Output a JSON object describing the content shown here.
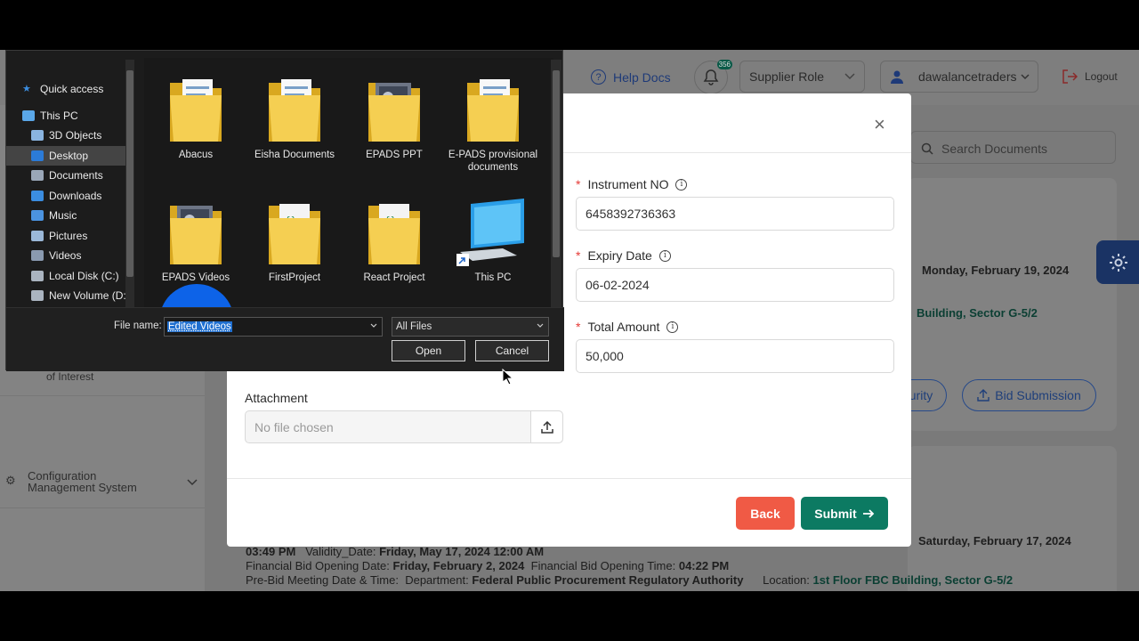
{
  "topbar": {
    "help_docs": "Help Docs",
    "notification_count": "356",
    "role_select": "Supplier Role",
    "username": "dawalancetraders",
    "logout": "Logout"
  },
  "search": {
    "placeholder": "Search Documents"
  },
  "sidebar": {
    "partial_item": "of Interest",
    "config_item": "Configuration Management System"
  },
  "background_cards": {
    "date1_fragment": "Monday, February 19, 2024",
    "location1_fragment": "Building, Sector G-5/2",
    "security_btn": "curity",
    "bid_submission_btn": "Bid Submission",
    "date2_fragment": "Saturday, February 17, 2024",
    "line1_time": "03:49 PM",
    "line1_label": "Validity_Date:",
    "line1_value": "Friday, May 17, 2024 12:00 AM",
    "line2_label": "Financial Bid Opening Date:",
    "line2_value": "Friday, February 2, 2024",
    "line2_label2": "Financial Bid Opening Time:",
    "line2_value2": "04:22 PM",
    "line3_label": "Pre-Bid Meeting Date & Time:",
    "line3_dept_label": "Department:",
    "line3_dept_value": "Federal Public Procurement Regulatory Authority",
    "line3_loc_label": "Location:",
    "line3_loc_value": "1st Floor FBC Building, Sector G-5/2"
  },
  "modal": {
    "close_symbol": "×",
    "instrument_label": "Instrument NO",
    "instrument_value": "6458392736363",
    "expiry_label": "Expiry Date",
    "expiry_value": "06-02-2024",
    "amount_label": "Total Amount",
    "amount_value": "50,000",
    "attachment_label": "Attachment",
    "file_placeholder": "No file chosen",
    "back_label": "Back",
    "submit_label": "Submit"
  },
  "file_dialog": {
    "nav_items": [
      {
        "label": "Quick access",
        "icon": "star-icon"
      },
      {
        "label": "This PC",
        "icon": "computer-icon"
      },
      {
        "label": "3D Objects",
        "icon": "cube-icon"
      },
      {
        "label": "Desktop",
        "icon": "desktop-icon"
      },
      {
        "label": "Documents",
        "icon": "document-icon"
      },
      {
        "label": "Downloads",
        "icon": "download-icon"
      },
      {
        "label": "Music",
        "icon": "music-icon"
      },
      {
        "label": "Pictures",
        "icon": "picture-icon"
      },
      {
        "label": "Videos",
        "icon": "video-icon"
      },
      {
        "label": "Local Disk (C:)",
        "icon": "disk-icon"
      },
      {
        "label": "New Volume (D:",
        "icon": "drive-icon"
      }
    ],
    "files": [
      {
        "label": "Abacus"
      },
      {
        "label": "Eisha Documents"
      },
      {
        "label": "EPADS PPT"
      },
      {
        "label": "E-PADS provisional documents"
      },
      {
        "label": "EPADS Videos"
      },
      {
        "label": "FirstProject"
      },
      {
        "label": "React Project"
      },
      {
        "label": "This PC"
      }
    ],
    "file_name_label": "File name:",
    "file_name_value": "Edited Videos",
    "file_type": "All Files",
    "open_label": "Open",
    "cancel_label": "Cancel"
  }
}
